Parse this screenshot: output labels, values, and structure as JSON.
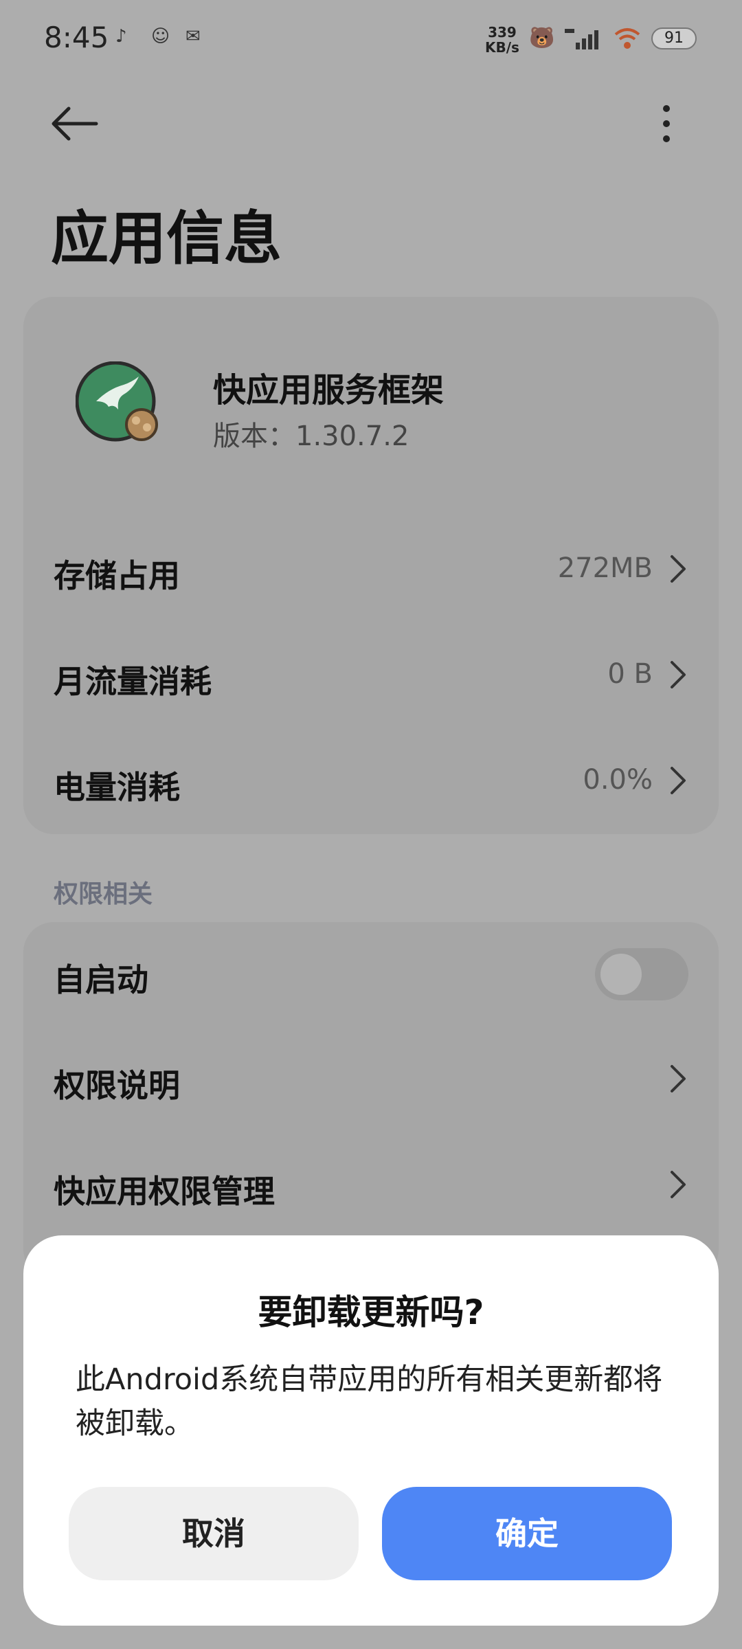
{
  "status_bar": {
    "time": "8:45",
    "net_speed_value": "339",
    "net_speed_unit": "KB/s",
    "battery": "91",
    "left_icons": [
      "tiktok-icon",
      "face-app-icon",
      "mail-app-icon"
    ],
    "right_icons": [
      "bear-sticker-icon",
      "signal-icon",
      "wifi-icon",
      "battery-icon"
    ]
  },
  "header": {
    "title": "应用信息"
  },
  "app": {
    "name": "快应用服务框架",
    "version": "版本：1.30.7.2",
    "icon": "hummingbird-app-icon",
    "icon_color": "#3e8b5f"
  },
  "usage": {
    "rows": [
      {
        "label": "存储占用",
        "value": "272MB"
      },
      {
        "label": "月流量消耗",
        "value": "0 B"
      },
      {
        "label": "电量消耗",
        "value": "0.0%"
      }
    ]
  },
  "permissions": {
    "section_label": "权限相关",
    "autostart": {
      "label": "自启动",
      "enabled": false
    },
    "rows": [
      {
        "label": "权限说明"
      },
      {
        "label": "快应用权限管理"
      }
    ]
  },
  "dialog": {
    "title": "要卸载更新吗?",
    "message": "此Android系统自带应用的所有相关更新都将被卸载。",
    "cancel_label": "取消",
    "confirm_label": "确定",
    "confirm_color": "#4e86f5"
  }
}
